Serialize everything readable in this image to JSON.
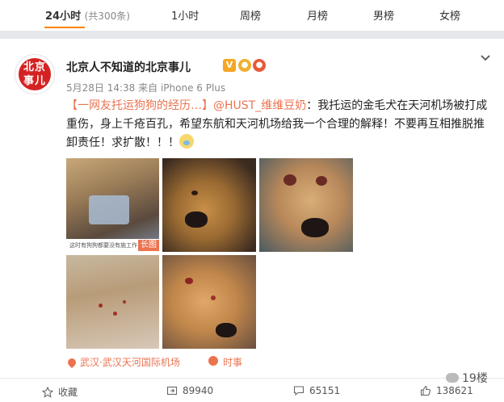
{
  "tabs": [
    {
      "label": "24小时",
      "count": "(共300条)"
    },
    {
      "label": "1小时"
    },
    {
      "label": "周榜"
    },
    {
      "label": "月榜"
    },
    {
      "label": "男榜"
    },
    {
      "label": "女榜"
    }
  ],
  "post": {
    "avatar_text": "北京\n事儿",
    "author": "北京人不知道的北京事儿",
    "badge": "V",
    "time": "5月28日 14:38",
    "source": "来自 iPhone 6 Plus",
    "text_intro": "【一网友托运狗狗的经历…】",
    "mention": "@HUST_维维豆奶",
    "text_body": "：我托运的金毛犬在天河机场被打成重伤，身上千疮百孔，希望东航和天河机场给我一个合理的解释！不要再互相推脱推卸责任！求扩散！！！",
    "photo1_caption": "这时有狗狗都要没有施工作",
    "long_image_label": "长图",
    "location": "武汉·武汉天河国际机场",
    "topic": "时事"
  },
  "actions": {
    "favorite": "收藏",
    "repost_count": "89940",
    "comment_count": "65151",
    "like_count": "138621"
  },
  "watermark": "19楼"
}
